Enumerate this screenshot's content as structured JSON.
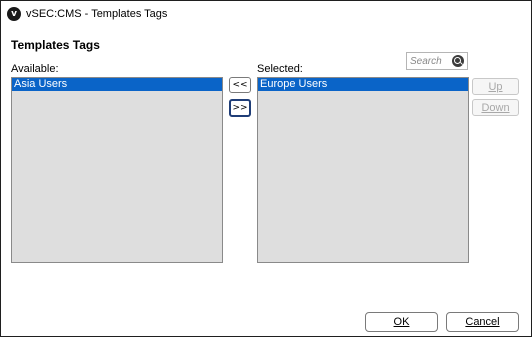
{
  "window": {
    "title": "vSEC:CMS - Templates Tags",
    "icon_letter": "v"
  },
  "heading": "Templates Tags",
  "available": {
    "label": "Available:",
    "items": [
      "Asia Users"
    ]
  },
  "selected": {
    "label": "Selected:",
    "items": [
      "Europe Users"
    ]
  },
  "transfer": {
    "remove_label": "<<",
    "add_label": ">>"
  },
  "search": {
    "placeholder": "Search",
    "value": ""
  },
  "order": {
    "up_label": "Up",
    "down_label": "Down"
  },
  "footer": {
    "ok_label": "OK",
    "cancel_label": "Cancel"
  },
  "colors": {
    "selection": "#0a64c8",
    "list_background": "#dedede",
    "focus_border": "#1f3d77"
  }
}
